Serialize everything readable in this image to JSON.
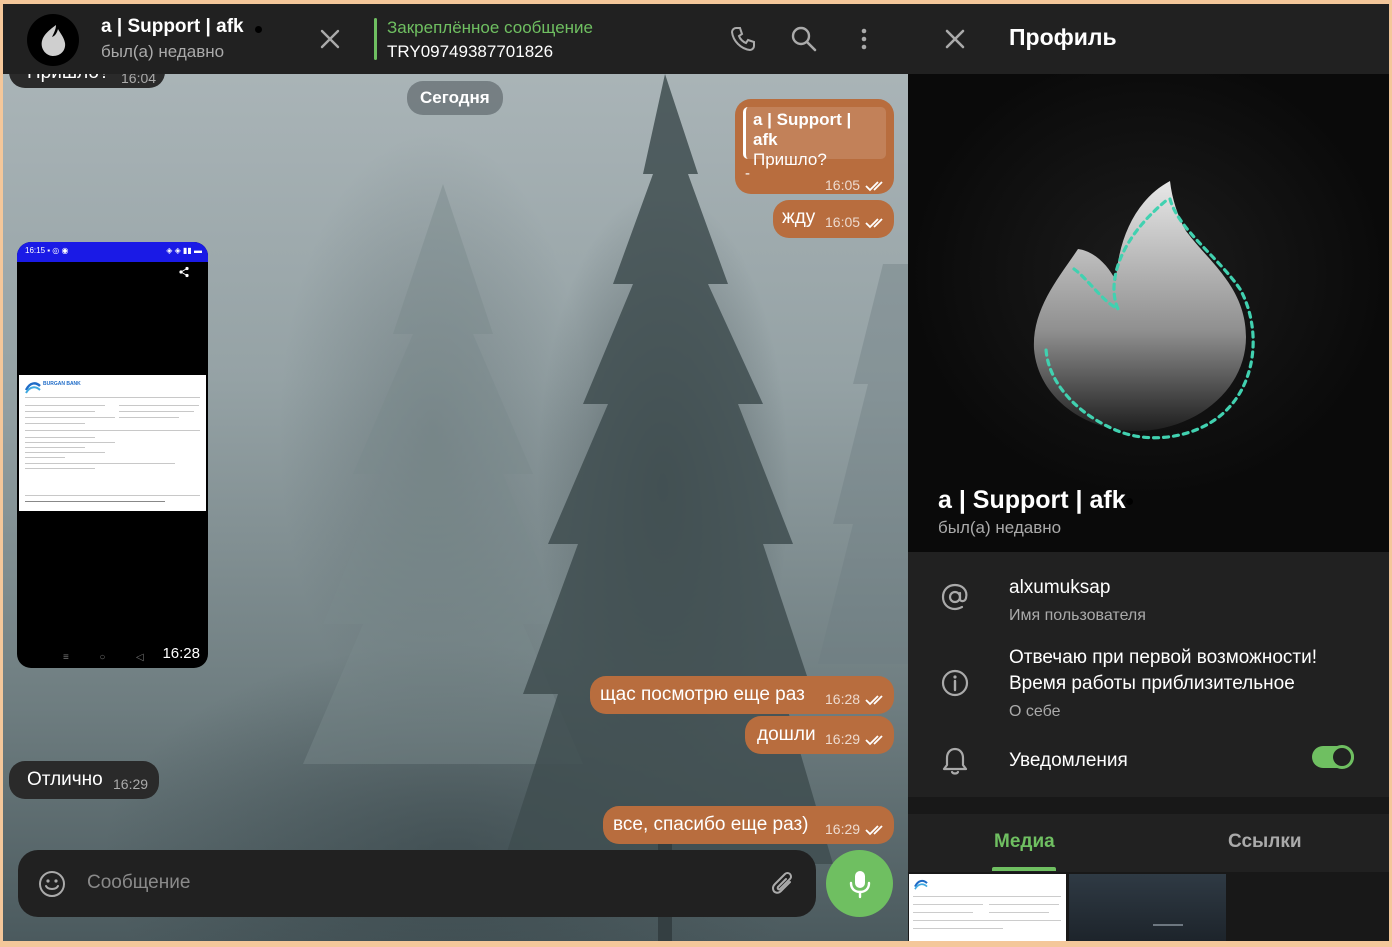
{
  "chat": {
    "title": "a | Support | afk",
    "status": "был(а) недавно",
    "pinned": {
      "label": "Закреплённое сообщение",
      "text": "TRY09749387701826"
    },
    "date_divider": "Сегодня",
    "messages": [
      {
        "dir": "in",
        "text": "Пришло?",
        "time": "16:04"
      },
      {
        "dir": "out",
        "reply_name": "a | Support | afk",
        "reply_text": "Пришло?",
        "text": "-",
        "time": "16:05"
      },
      {
        "dir": "out",
        "text": "жду",
        "time": "16:05"
      },
      {
        "dir": "in",
        "type": "photo",
        "time": "16:28"
      },
      {
        "dir": "out",
        "text": "щас посмотрю еще раз",
        "time": "16:28"
      },
      {
        "dir": "out",
        "text": "дошли",
        "time": "16:29"
      },
      {
        "dir": "in",
        "text": "Отлично",
        "time": "16:29"
      },
      {
        "dir": "out",
        "text": "все, спасибо еще раз)",
        "time": "16:29"
      }
    ],
    "composer_placeholder": "Сообщение",
    "receipt": {
      "bank": "BURGAN BANK"
    }
  },
  "profile": {
    "title": "Профиль",
    "name": "a | Support | afk",
    "status": "был(а) недавно",
    "username": "alxumuksap",
    "username_label": "Имя пользователя",
    "bio_line1": "Отвечаю при первой возможности!",
    "bio_line2": "Время работы приблизительное",
    "bio_label": "О себе",
    "notifications_label": "Уведомления",
    "notifications_on": true,
    "tabs": [
      "Медиа",
      "Ссылки"
    ]
  },
  "colors": {
    "accent": "#6fbf61",
    "outgoing_bubble": "#b86d3e",
    "incoming_bubble": "#2a2a2a",
    "panel": "#212121"
  }
}
